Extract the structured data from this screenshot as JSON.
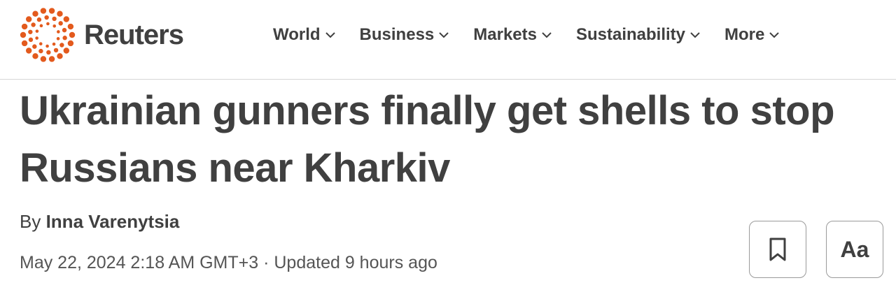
{
  "brand": {
    "name": "Reuters",
    "accent_color": "#e35a1d"
  },
  "nav": {
    "items": [
      {
        "label": "World",
        "icon": "chevron-down-icon"
      },
      {
        "label": "Business",
        "icon": "chevron-down-icon"
      },
      {
        "label": "Markets",
        "icon": "chevron-down-icon"
      },
      {
        "label": "Sustainability",
        "icon": "chevron-down-icon"
      },
      {
        "label": "More",
        "icon": "chevron-down-icon"
      }
    ]
  },
  "article": {
    "headline": "Ukrainian gunners finally get shells to stop Russians near Kharkiv",
    "by_prefix": "By",
    "author": "Inna Varenytsia",
    "dateline": "May 22, 2024 2:18 AM GMT+3 · Updated 9 hours ago"
  },
  "actions": {
    "bookmark_icon": "bookmark-icon",
    "text_size_label": "Aa"
  }
}
